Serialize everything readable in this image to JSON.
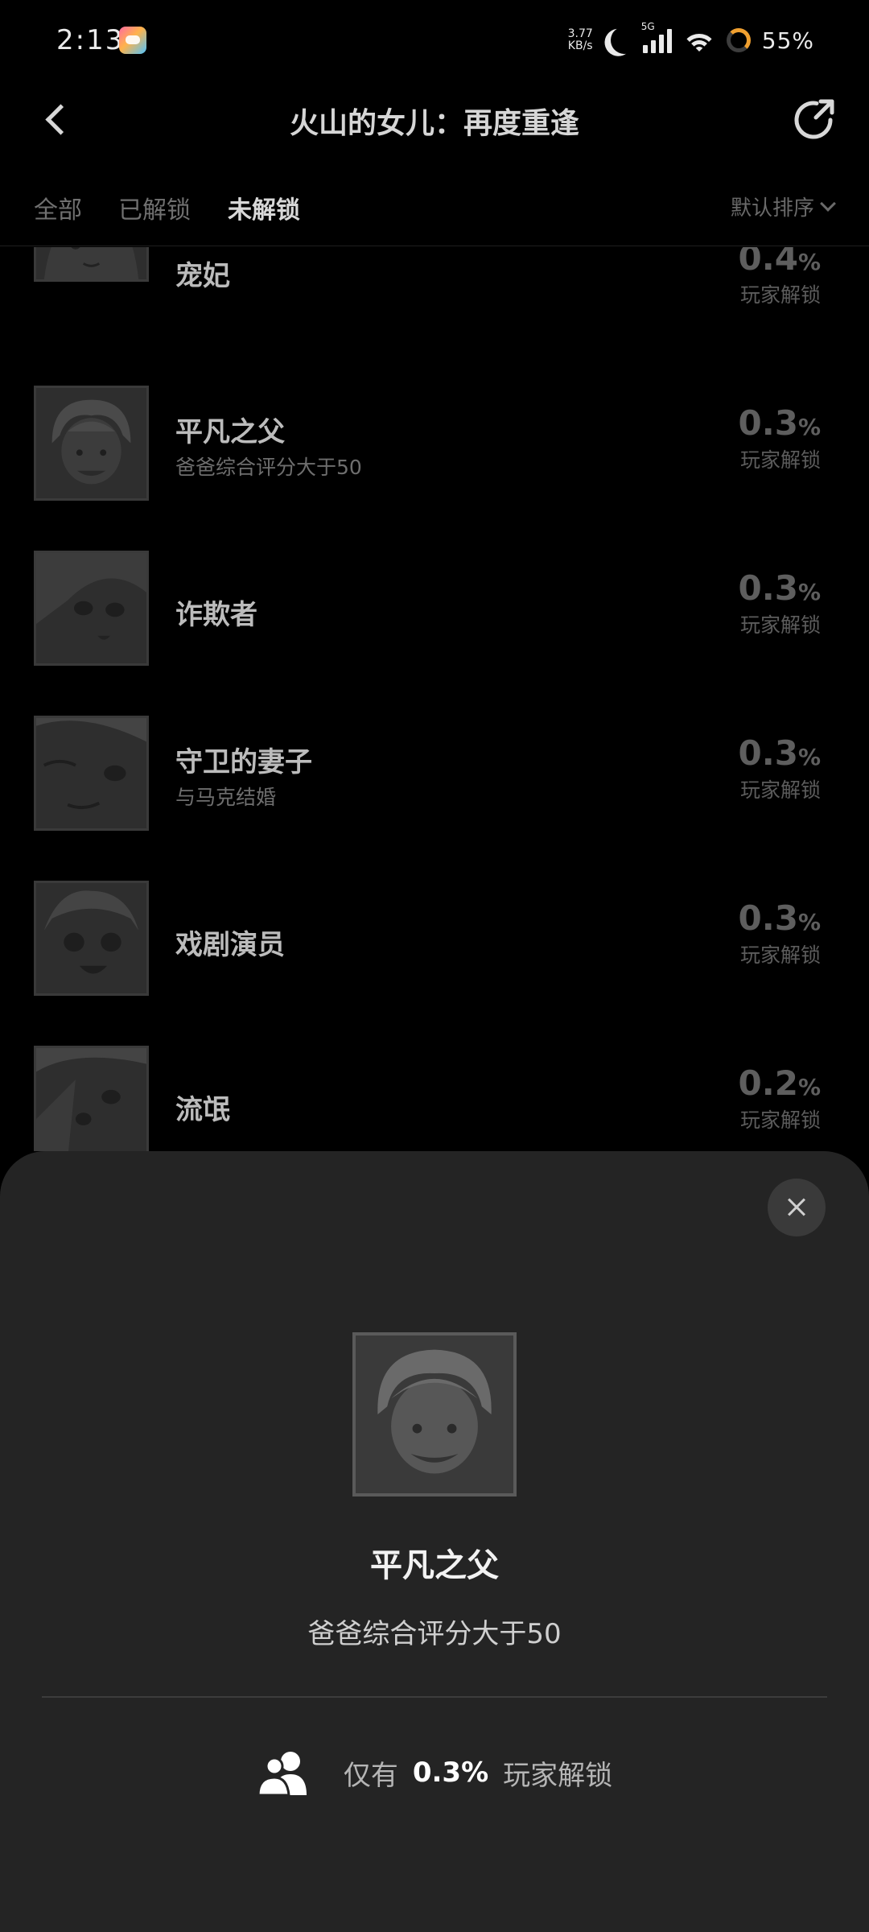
{
  "status_bar": {
    "time": "2:13",
    "net_speed_top": "3.77",
    "net_speed_bottom": "KB/s",
    "network": "5G",
    "battery": "55%"
  },
  "header": {
    "title": "火山的女儿：再度重逢"
  },
  "tabs": [
    {
      "label": "全部",
      "active": false
    },
    {
      "label": "已解锁",
      "active": false
    },
    {
      "label": "未解锁",
      "active": true
    }
  ],
  "sort": {
    "label": "默认排序"
  },
  "achievements": [
    {
      "name": "宠妃",
      "desc": "",
      "rate": "0.4",
      "unit": "%",
      "rate_label": "玩家解锁"
    },
    {
      "name": "平凡之父",
      "desc": "爸爸综合评分大于50",
      "rate": "0.3",
      "unit": "%",
      "rate_label": "玩家解锁"
    },
    {
      "name": "诈欺者",
      "desc": "",
      "rate": "0.3",
      "unit": "%",
      "rate_label": "玩家解锁"
    },
    {
      "name": "守卫的妻子",
      "desc": "与马克结婚",
      "rate": "0.3",
      "unit": "%",
      "rate_label": "玩家解锁"
    },
    {
      "name": "戏剧演员",
      "desc": "",
      "rate": "0.3",
      "unit": "%",
      "rate_label": "玩家解锁"
    },
    {
      "name": "流氓",
      "desc": "",
      "rate": "0.2",
      "unit": "%",
      "rate_label": "玩家解锁"
    }
  ],
  "sheet": {
    "title": "平凡之父",
    "desc": "爸爸综合评分大于50",
    "stat_prefix": "仅有",
    "stat_value": "0.3%",
    "stat_suffix": "玩家解锁"
  }
}
